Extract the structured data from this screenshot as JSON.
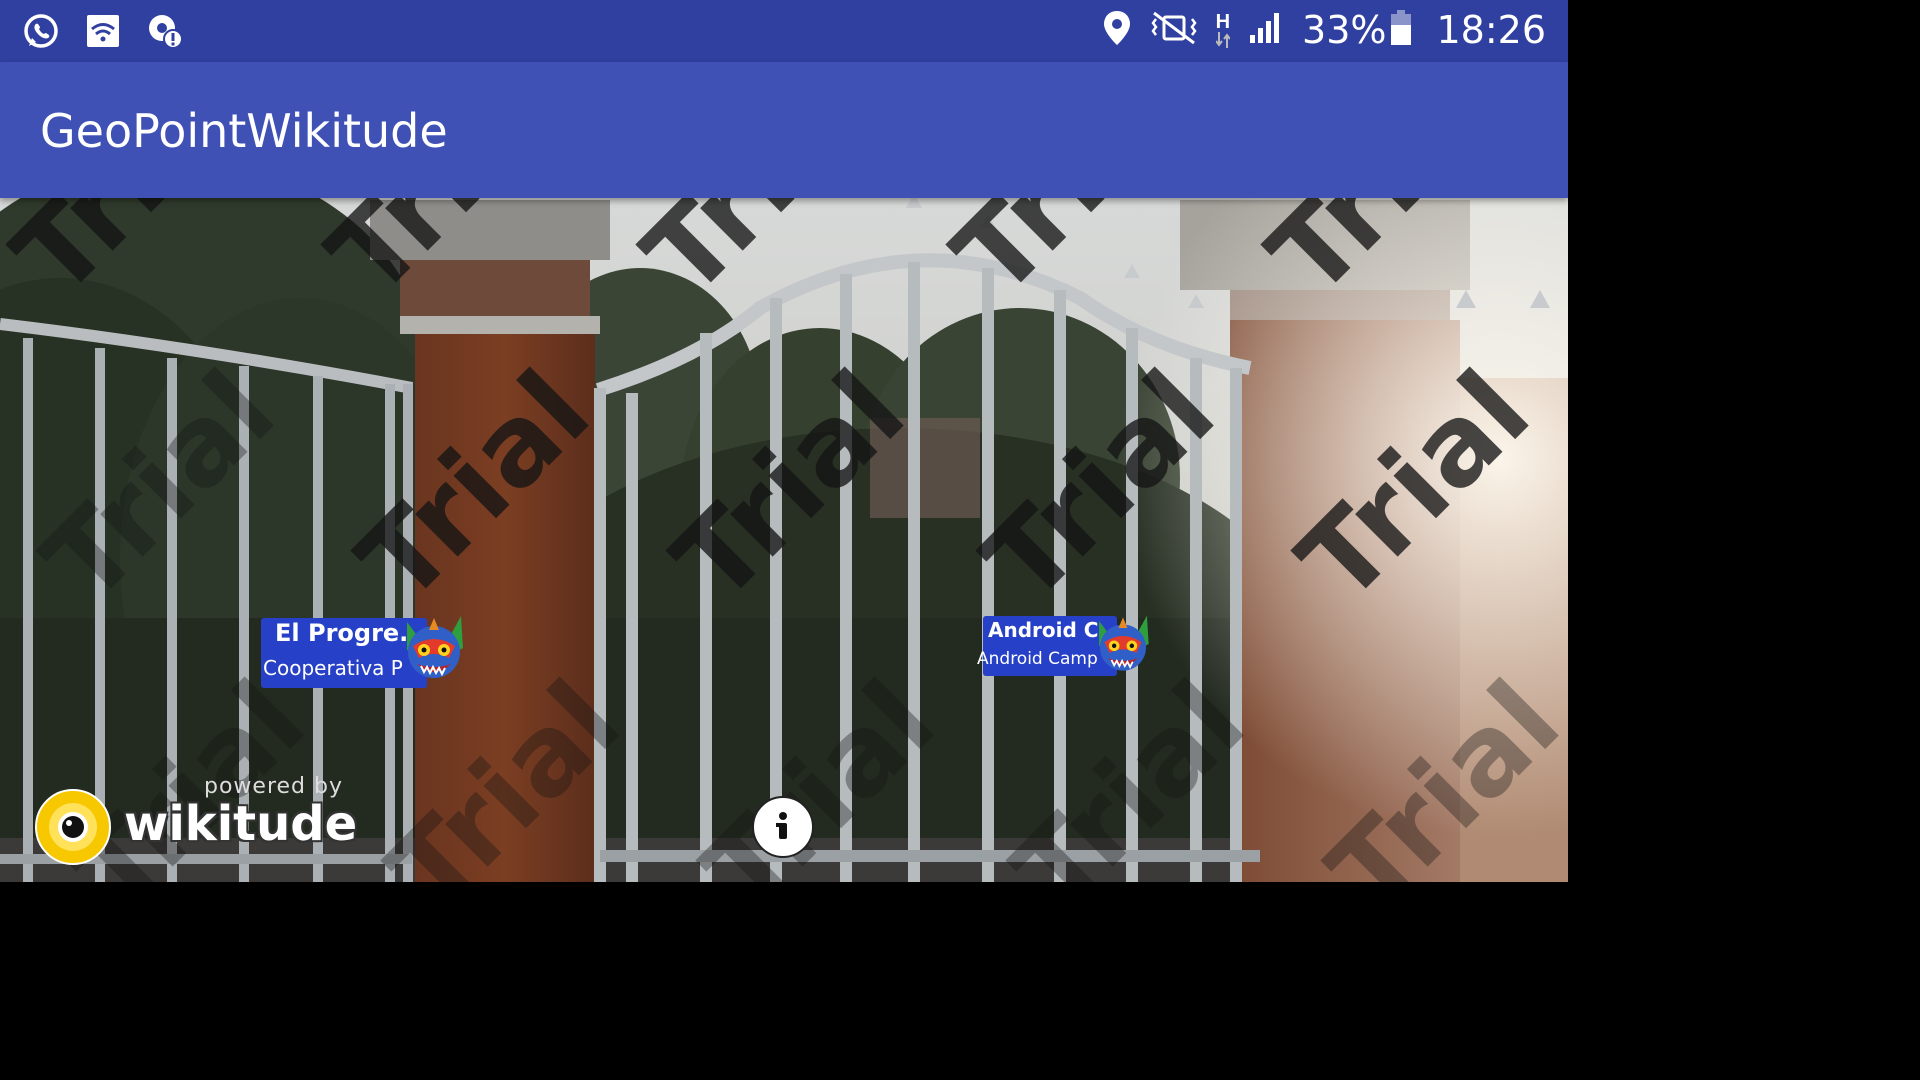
{
  "status_bar": {
    "battery": "33%",
    "time": "18:26",
    "network_type": "H",
    "icons_left": [
      "whatsapp-icon",
      "wifi-file-icon",
      "location-alert-icon"
    ],
    "icons_right": [
      "location-icon",
      "vibrate-icon",
      "network-h-icon",
      "signal-icon",
      "battery-icon"
    ]
  },
  "app_bar": {
    "title": "GeoPointWikitude"
  },
  "ar_view": {
    "watermark_text": "Trial",
    "pois": [
      {
        "title": "El Progre...",
        "description": "Cooperativa P",
        "marker_icon": "dragon-mask-icon"
      },
      {
        "title": "Android C...",
        "description": "Android Camp",
        "marker_icon": "dragon-mask-icon"
      }
    ],
    "info_button_icon": "info-icon",
    "branding": {
      "powered_by": "powered by",
      "name": "wikitude",
      "logo_icon": "wikitude-eye-icon"
    }
  },
  "colors": {
    "status_bar": "#3040A0",
    "app_bar": "#3F51B5",
    "poi_label": "#2740C8"
  }
}
